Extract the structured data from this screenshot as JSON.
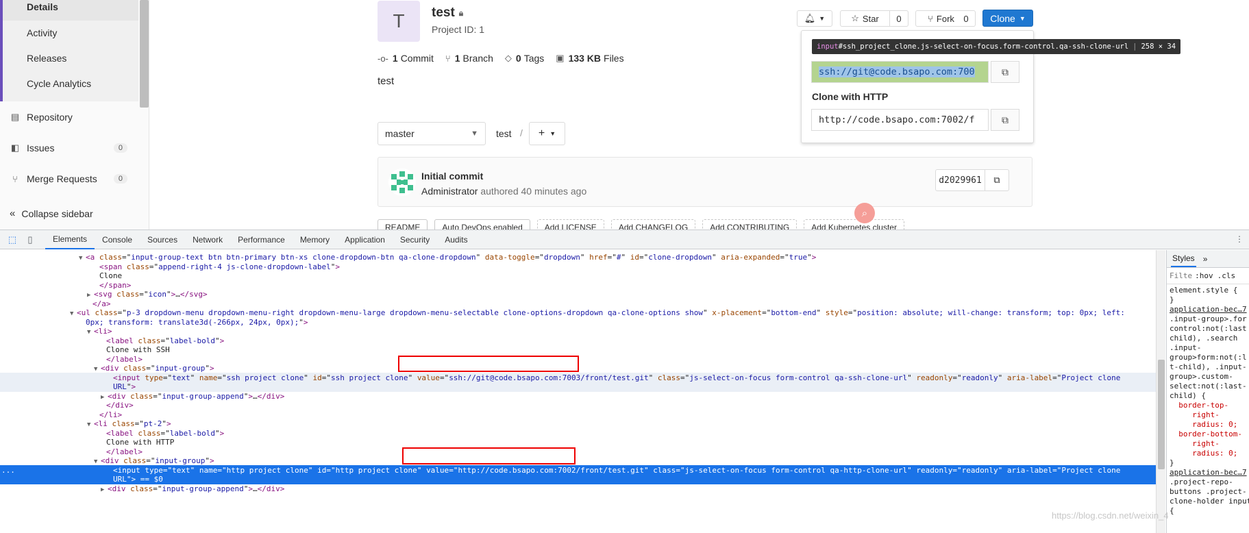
{
  "sidebar": {
    "sub_items": [
      "Details",
      "Activity",
      "Releases",
      "Cycle Analytics"
    ],
    "nav": [
      {
        "label": "Repository",
        "icon": "repository-icon"
      },
      {
        "label": "Issues",
        "icon": "issues-icon",
        "count": "0"
      },
      {
        "label": "Merge Requests",
        "icon": "merge-request-icon",
        "count": "0"
      }
    ],
    "collapse_label": "Collapse sidebar"
  },
  "project": {
    "avatar_letter": "T",
    "name": "test",
    "id_text": "Project ID: 1",
    "stats": [
      {
        "count": "1",
        "label": "Commit"
      },
      {
        "count": "1",
        "label": "Branch"
      },
      {
        "count": "0",
        "label": "Tags"
      },
      {
        "count": "133 KB",
        "label": "Files"
      }
    ],
    "description": "test"
  },
  "header_buttons": {
    "star_label": "Star",
    "star_count": "0",
    "fork_label": "Fork",
    "fork_count": "0",
    "clone_label": "Clone"
  },
  "clone_dropdown": {
    "tooltip_tag": "input",
    "tooltip_selector": "#ssh_project_clone.js-select-on-focus.form-control.qa-ssh-clone-url",
    "tooltip_size": "258 × 34",
    "ssh_value": "ssh://git@code.bsapo.com:700",
    "http_label": "Clone with HTTP",
    "http_value": "http://code.bsapo.com:7002/f"
  },
  "branch_bar": {
    "branch": "master",
    "crumb": "test",
    "sep": "/"
  },
  "last_commit": {
    "title": "Initial commit",
    "author": "Administrator",
    "meta": "authored 40 minutes ago",
    "sha": "d2029961"
  },
  "file_chips": [
    "README",
    "Auto DevOps enabled",
    "Add LICENSE",
    "Add CHANGELOG",
    "Add CONTRIBUTING",
    "Add Kubernetes cluster"
  ],
  "devtools": {
    "tabs": [
      "Elements",
      "Console",
      "Sources",
      "Network",
      "Performance",
      "Memory",
      "Application",
      "Security",
      "Audits"
    ],
    "lines": [
      {
        "indent": 125,
        "tri": "▼",
        "html": "<span class=\"tg\">&lt;a</span> <span class=\"at\">class</span>=\"<span class=\"av\">input-group-text btn btn-primary btn-xs clone-dropdown-btn qa-clone-dropdown</span>\" <span class=\"at\">data-toggle</span>=\"<span class=\"av\">dropdown</span>\" <span class=\"at\">href</span>=\"<span class=\"av\">#</span>\" <span class=\"at\">id</span>=\"<span class=\"av\">clone-dropdown</span>\" <span class=\"at\">aria-expanded</span>=\"<span class=\"av\">true</span>\"<span class=\"tg\">&gt;</span>"
      },
      {
        "indent": 145,
        "tri": "",
        "html": "<span class=\"tg\">&lt;span</span> <span class=\"at\">class</span>=\"<span class=\"av\">append-right-4 js-clone-dropdown-label</span>\"<span class=\"tg\">&gt;</span>"
      },
      {
        "indent": 145,
        "tri": "",
        "html": "Clone"
      },
      {
        "indent": 145,
        "tri": "",
        "html": "<span class=\"tg\">&lt;/span&gt;</span>"
      },
      {
        "indent": 137,
        "tri": "▶",
        "html": "<span class=\"tg\">&lt;svg</span> <span class=\"at\">class</span>=\"<span class=\"av\">icon</span>\"<span class=\"tg\">&gt;</span>…<span class=\"tg\">&lt;/svg&gt;</span>"
      },
      {
        "indent": 135,
        "tri": "",
        "html": "<span class=\"tg\">&lt;/a&gt;</span>"
      },
      {
        "indent": 112,
        "tri": "▼",
        "html": "<span class=\"tg\">&lt;ul</span> <span class=\"at\">class</span>=\"<span class=\"av\">p-3 dropdown-menu dropdown-menu-right dropdown-menu-large dropdown-menu-selectable clone-options-dropdown qa-clone-options show</span>\" <span class=\"at\">x-placement</span>=\"<span class=\"av\">bottom-end</span>\" <span class=\"at\">style</span>=\"<span class=\"av\">position: absolute; will-change: transform; top: 0px; left:</span>"
      },
      {
        "indent": 125,
        "tri": "",
        "html": "<span class=\"av\">0px; transform: translate3d(-266px, 24px, 0px);</span>\"<span class=\"tg\">&gt;</span>"
      },
      {
        "indent": 137,
        "tri": "▼",
        "html": "<span class=\"tg\">&lt;li&gt;</span>"
      },
      {
        "indent": 155,
        "tri": "",
        "html": "<span class=\"tg\">&lt;label</span> <span class=\"at\">class</span>=\"<span class=\"av\">label-bold</span>\"<span class=\"tg\">&gt;</span>"
      },
      {
        "indent": 155,
        "tri": "",
        "html": "Clone with SSH"
      },
      {
        "indent": 155,
        "tri": "",
        "html": "<span class=\"tg\">&lt;/label&gt;</span>"
      },
      {
        "indent": 147,
        "tri": "▼",
        "html": "<span class=\"tg\">&lt;div</span> <span class=\"at\">class</span>=\"<span class=\"av\">input-group</span>\"<span class=\"tg\">&gt;</span>"
      },
      {
        "indent": 165,
        "tri": "",
        "html": "<span class=\"tg\">&lt;input</span> <span class=\"at\">type</span>=\"<span class=\"av\">text</span>\" <span class=\"at\">name</span>=\"<span class=\"av\">ssh_project_clone</span>\" <span class=\"at\">id</span>=\"<span class=\"av\">ssh_project_clone</span>\" <span class=\"at\">value</span>=\"<span class=\"av\">ssh://git@code.bsapo.com:7003/front/test.git</span>\" <span class=\"at\">class</span>=\"<span class=\"av\">js-select-on-focus form-control qa-ssh-clone-url</span>\" <span class=\"at\">readonly</span>=\"<span class=\"av\">readonly</span>\" <span class=\"at\">aria-label</span>=\"<span class=\"av\">Project clone</span>",
        "cls": "hl"
      },
      {
        "indent": 165,
        "tri": "",
        "html": "<span class=\"av\">URL</span>\"<span class=\"tg\">&gt;</span>",
        "cls": "hl"
      },
      {
        "indent": 157,
        "tri": "▶",
        "html": "<span class=\"tg\">&lt;div</span> <span class=\"at\">class</span>=\"<span class=\"av\">input-group-append</span>\"<span class=\"tg\">&gt;</span>…<span class=\"tg\">&lt;/div&gt;</span>"
      },
      {
        "indent": 155,
        "tri": "",
        "html": "<span class=\"tg\">&lt;/div&gt;</span>"
      },
      {
        "indent": 145,
        "tri": "",
        "html": "<span class=\"tg\">&lt;/li&gt;</span>"
      },
      {
        "indent": 137,
        "tri": "▼",
        "html": "<span class=\"tg\">&lt;li</span> <span class=\"at\">class</span>=\"<span class=\"av\">pt-2</span>\"<span class=\"tg\">&gt;</span>"
      },
      {
        "indent": 155,
        "tri": "",
        "html": "<span class=\"tg\">&lt;label</span> <span class=\"at\">class</span>=\"<span class=\"av\">label-bold</span>\"<span class=\"tg\">&gt;</span>"
      },
      {
        "indent": 155,
        "tri": "",
        "html": "Clone with HTTP"
      },
      {
        "indent": 155,
        "tri": "",
        "html": "<span class=\"tg\">&lt;/label&gt;</span>"
      },
      {
        "indent": 147,
        "tri": "▼",
        "html": "<span class=\"tg\">&lt;div</span> <span class=\"at\">class</span>=\"<span class=\"av\">input-group</span>\"<span class=\"tg\">&gt;</span>"
      },
      {
        "indent": 165,
        "tri": "",
        "html": "<span class=\"tg\">&lt;input</span> <span class=\"at\">type</span>=\"<span class=\"av\">text</span>\" <span class=\"at\">name</span>=\"<span class=\"av\">http_project_clone</span>\" <span class=\"at\">id</span>=\"<span class=\"av\">http_project_clone</span>\" <span class=\"at\">value</span>=\"<span class=\"av\">http://code.bsapo.com:7002/front/test.git</span>\" <span class=\"at\">class</span>=\"<span class=\"av\">js-select-on-focus form-control qa-http-clone-url</span>\" <span class=\"at\">readonly</span>=\"<span class=\"av\">readonly</span>\" <span class=\"at\">aria-label</span>=\"<span class=\"av\">Project clone</span>",
        "cls": "sel",
        "prefix": "..."
      },
      {
        "indent": 165,
        "tri": "",
        "html": "<span class=\"av\">URL</span>\"<span class=\"tg\">&gt;</span> == $0",
        "cls": "sel"
      },
      {
        "indent": 157,
        "tri": "▶",
        "html": "<span class=\"tg\">&lt;div</span> <span class=\"at\">class</span>=\"<span class=\"av\">input-group-append</span>\"<span class=\"tg\">&gt;</span>…<span class=\"tg\">&lt;/div&gt;</span>"
      }
    ],
    "styles_tabs": [
      "Styles",
      "»"
    ],
    "styles_filter": "Filte",
    "styles_hov": ":hov",
    "styles_cls": ".cls",
    "styles_lines": [
      {
        "t": "element.style {",
        "c": ""
      },
      {
        "t": "}",
        "c": ""
      },
      {
        "t": "application-bec…7",
        "c": "link"
      },
      {
        "t": ".input-group>.for",
        "c": ""
      },
      {
        "t": "control:not(:last",
        "c": ""
      },
      {
        "t": "child), .search",
        "c": ""
      },
      {
        "t": ".input-",
        "c": ""
      },
      {
        "t": "group>form:not(:l",
        "c": ""
      },
      {
        "t": "t-child), .input-",
        "c": ""
      },
      {
        "t": "group>.custom-",
        "c": ""
      },
      {
        "t": "select:not(:last-",
        "c": ""
      },
      {
        "t": "child) {",
        "c": ""
      },
      {
        "t": "  border-top-",
        "c": "prop"
      },
      {
        "t": "     right-",
        "c": "prop"
      },
      {
        "t": "     radius: 0;",
        "c": "prop"
      },
      {
        "t": "  border-bottom-",
        "c": "prop"
      },
      {
        "t": "     right-",
        "c": "prop"
      },
      {
        "t": "     radius: 0;",
        "c": "prop"
      },
      {
        "t": "}",
        "c": ""
      },
      {
        "t": "application-bec…7",
        "c": "link"
      },
      {
        "t": ".project-repo-",
        "c": ""
      },
      {
        "t": "buttons .project-",
        "c": ""
      },
      {
        "t": "clone-holder input",
        "c": ""
      },
      {
        "t": "{",
        "c": ""
      }
    ]
  },
  "watermark": "https://blog.csdn.net/weixin_4"
}
